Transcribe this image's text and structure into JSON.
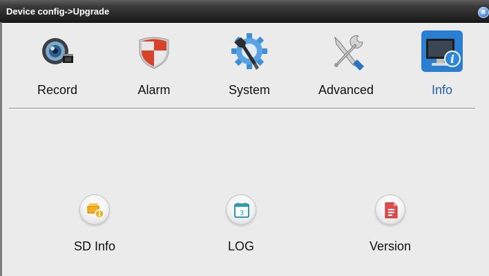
{
  "window": {
    "title": "Device config->Upgrade",
    "close_symbol": "×"
  },
  "tabs": [
    {
      "label": "Record",
      "icon": "record-icon",
      "selected": false
    },
    {
      "label": "Alarm",
      "icon": "alarm-shield-icon",
      "selected": false
    },
    {
      "label": "System",
      "icon": "system-gear-icon",
      "selected": false
    },
    {
      "label": "Advanced",
      "icon": "advanced-tools-icon",
      "selected": false
    },
    {
      "label": "Info",
      "icon": "info-monitor-icon",
      "selected": true
    }
  ],
  "items": [
    {
      "label": "SD Info",
      "icon": "sd-info-icon"
    },
    {
      "label": "LOG",
      "icon": "log-calendar-icon",
      "icon_text": "3"
    },
    {
      "label": "Version",
      "icon": "version-document-icon"
    }
  ],
  "colors": {
    "selected_tab_label": "#1f5fa6",
    "window_background": "#ebebeb",
    "titlebar": "#1b1b1b"
  }
}
